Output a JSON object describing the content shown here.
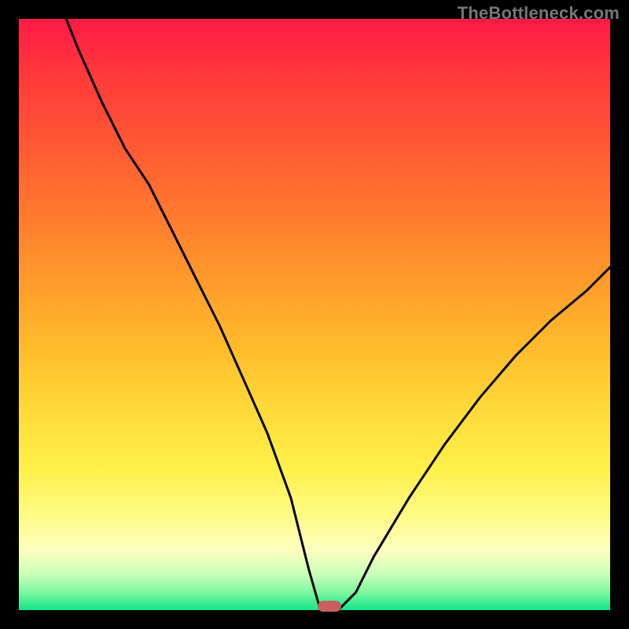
{
  "watermark": "TheBottleneck.com",
  "colors": {
    "background": "#000000",
    "curve": "#000000",
    "marker": "#c86060"
  },
  "chart_data": {
    "type": "line",
    "title": "",
    "xlabel": "",
    "ylabel": "",
    "xlim": [
      0,
      100
    ],
    "ylim": [
      0,
      100
    ],
    "grid": false,
    "legend": false,
    "gradient_stops": [
      {
        "pct": 0,
        "color": "#ff1a46"
      },
      {
        "pct": 10,
        "color": "#ff3a3a"
      },
      {
        "pct": 22,
        "color": "#ff5a33"
      },
      {
        "pct": 33,
        "color": "#ff7a2e"
      },
      {
        "pct": 44,
        "color": "#ff9a2b"
      },
      {
        "pct": 55,
        "color": "#ffba2b"
      },
      {
        "pct": 66,
        "color": "#ffd93a"
      },
      {
        "pct": 76,
        "color": "#fff04a"
      },
      {
        "pct": 84,
        "color": "#fffb86"
      },
      {
        "pct": 90,
        "color": "#fdffc0"
      },
      {
        "pct": 94,
        "color": "#c8ffb8"
      },
      {
        "pct": 97,
        "color": "#7cf7a0"
      },
      {
        "pct": 100,
        "color": "#13e58a"
      }
    ],
    "series": [
      {
        "name": "bottleneck-curve",
        "x": [
          8,
          10,
          14,
          18,
          22,
          26,
          30,
          34,
          38,
          42,
          46,
          49,
          51,
          54,
          57,
          60,
          66,
          72,
          78,
          84,
          90,
          96,
          100
        ],
        "values": [
          100,
          95,
          86,
          78,
          72,
          64,
          56,
          48,
          39,
          30,
          19,
          7,
          0,
          0,
          3,
          9,
          19,
          28,
          36,
          43,
          49,
          54,
          58
        ]
      }
    ],
    "marker": {
      "x": 52.5,
      "y": 0
    }
  }
}
